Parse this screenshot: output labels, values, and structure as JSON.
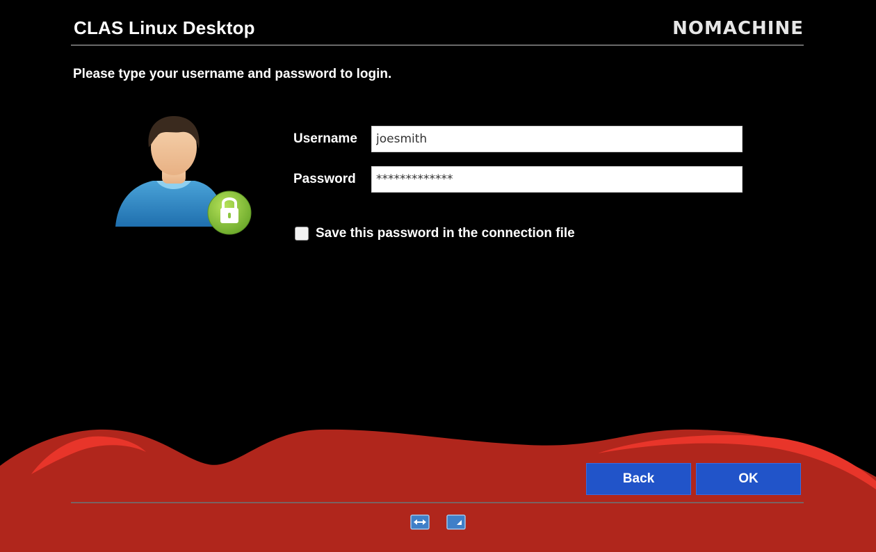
{
  "window": {
    "title": "CLAS Linux Desktop",
    "brand_logo": "NOMACHINE"
  },
  "login": {
    "instructions": "Please type your username and password to login.",
    "avatar_icon": "user-lock-icon",
    "username_label": "Username",
    "username_value": "joesmith",
    "password_label": "Password",
    "password_value": "*************",
    "save_password_label": "Save this password in the connection file",
    "save_password_checked": false
  },
  "buttons": {
    "back": "Back",
    "ok": "OK"
  },
  "footer": {
    "icons": [
      "fit-to-window-icon",
      "resize-window-icon"
    ]
  },
  "colors": {
    "background": "#000000",
    "wave_red": "#b0261c",
    "wave_highlight": "#e8352a",
    "button_blue": "#2154c9",
    "lock_green": "#8cc63f"
  }
}
